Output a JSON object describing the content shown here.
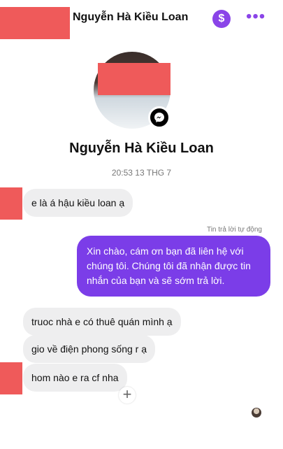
{
  "header": {
    "title": "Nguyễn Hà Kiều Loan",
    "dollar_icon": "dollar-icon",
    "more_icon": "more-icon"
  },
  "profile": {
    "name": "Nguyễn Hà Kiều Loan",
    "timestamp": "20:53 13 THG 7"
  },
  "messages": {
    "incoming_1": "e là á hậu kiều loan ạ",
    "auto_reply_label": "Tin trả lời tự động",
    "outgoing_1": "Xin chào, cám ơn bạn đã liên hệ với chúng tôi. Chúng tôi đã nhận được tin nhắn của bạn và sẽ sớm trả lời.",
    "incoming_2": "truoc nhà e có thuê quán mình ạ",
    "incoming_3": "gio về điện phong sống r ạ",
    "incoming_4": "hom nào e ra cf nha"
  },
  "colors": {
    "accent": "#8a44e8",
    "outgoing_bubble": "#7b3de8",
    "incoming_bubble": "#eeeeef",
    "redaction": "#ef5a5a"
  }
}
